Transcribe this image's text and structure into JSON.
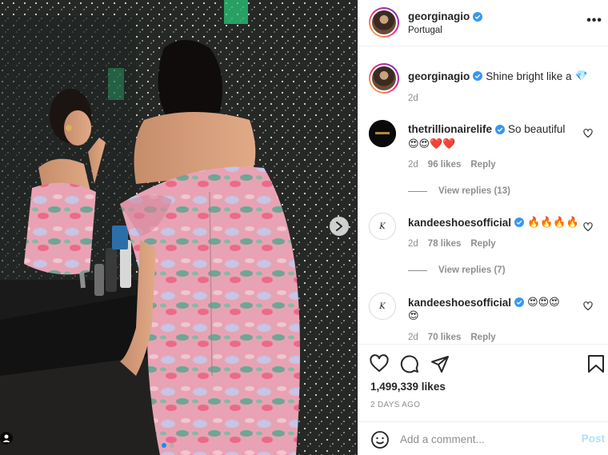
{
  "post": {
    "username": "georginagio",
    "location": "Portugal",
    "more_label": "•••",
    "caption_text": "Shine bright like a",
    "caption_emoji": "💎",
    "caption_time": "2d",
    "likes": "1,499,339 likes",
    "date": "2 DAYS AGO"
  },
  "comments": [
    {
      "username": "thetrillionairelife",
      "text": "So beautiful",
      "emoji": "😍😍❤️❤️",
      "time": "2d",
      "likes": "96 likes",
      "reply_label": "Reply",
      "view_replies": "View replies (13)"
    },
    {
      "username": "kandeeshoesofficial",
      "text": "",
      "emoji": "🔥🔥🔥🔥",
      "time": "2d",
      "likes": "78 likes",
      "reply_label": "Reply",
      "view_replies": "View replies (7)"
    },
    {
      "username": "kandeeshoesofficial",
      "text": "",
      "emoji": "😍😍😍",
      "emoji2": "😍",
      "time": "2d",
      "likes": "70 likes",
      "reply_label": "Reply"
    }
  ],
  "comment_box": {
    "placeholder": "Add a comment...",
    "post_label": "Post"
  },
  "carousel": {
    "current": 1,
    "total": 2
  },
  "colors": {
    "verified": "#3897f0",
    "link": "#0095f6",
    "post_disabled": "#b2dffc",
    "muted": "#8e8e8e"
  },
  "icons": [
    "more-icon",
    "verified-icon",
    "heart-icon",
    "comment-icon",
    "share-icon",
    "save-icon",
    "emoji-icon",
    "next-arrow-icon",
    "tag-user-icon"
  ]
}
